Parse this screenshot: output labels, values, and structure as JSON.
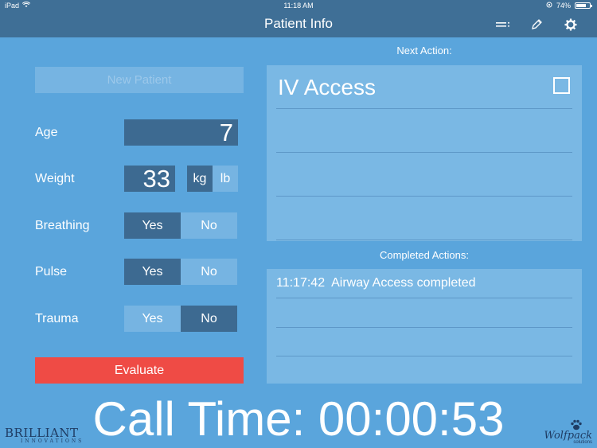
{
  "status_bar": {
    "device": "iPad",
    "time": "11:18 AM",
    "battery": "74%",
    "battery_level": 0.74
  },
  "nav": {
    "title": "Patient Info",
    "icons": [
      "menu-lines-icon",
      "pencil-icon",
      "gear-icon"
    ]
  },
  "form": {
    "new_patient_label": "New Patient",
    "age_label": "Age",
    "age_value": "7",
    "weight_label": "Weight",
    "weight_value": "33",
    "unit_options": [
      "kg",
      "lb"
    ],
    "unit_selected": "kg",
    "breathing_label": "Breathing",
    "breathing_selected": "Yes",
    "pulse_label": "Pulse",
    "pulse_selected": "Yes",
    "trauma_label": "Trauma",
    "trauma_selected": "No",
    "yes_label": "Yes",
    "no_label": "No",
    "evaluate_label": "Evaluate"
  },
  "next_action": {
    "section_label": "Next Action:",
    "title": "IV Access",
    "checked": false
  },
  "completed_actions": {
    "section_label": "Completed Actions:",
    "items": [
      {
        "time": "11:17:42",
        "text": "Airway Access completed"
      }
    ]
  },
  "call_time": {
    "text": "Call Time: 00:00:53"
  },
  "logos": {
    "left_big": "BRILLIANT",
    "left_small": "INNOVATIONS",
    "right_big": "Wolfpack",
    "right_small": "solutions"
  },
  "colors": {
    "background": "#5aa5dc",
    "bar": "#3f6f96",
    "selected": "#3d6a91",
    "unselected": "#76b4e2",
    "evaluate": "#ef4b45",
    "panel": "#7ab8e4"
  }
}
